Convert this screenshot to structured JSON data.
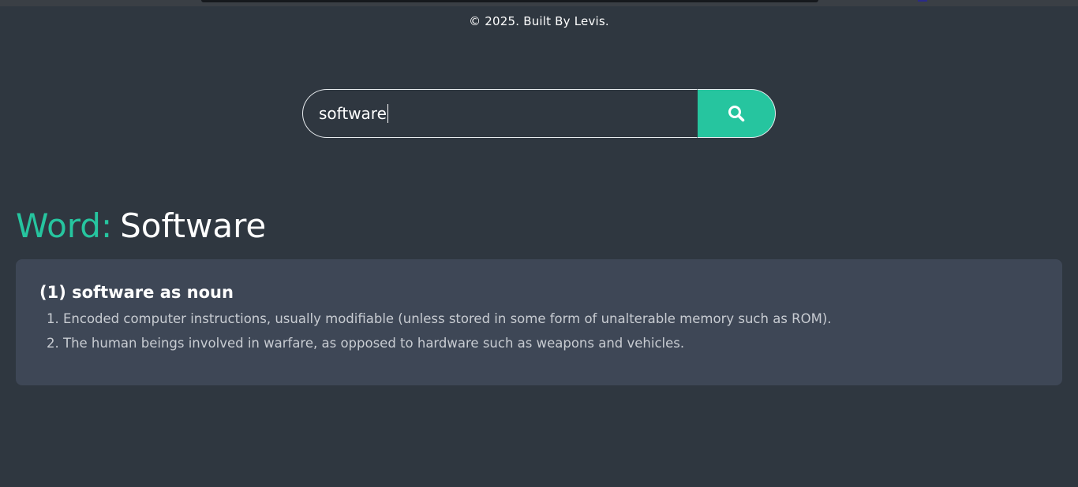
{
  "footer": {
    "credit": "© 2025. Built By Levis."
  },
  "search": {
    "value": "software",
    "button_icon": "search-icon"
  },
  "result": {
    "word_label": "Word:",
    "word": "Software",
    "meanings": [
      {
        "title": "(1) software as noun",
        "definitions": [
          "Encoded computer instructions, usually modifiable (unless stored in some form of unalterable memory such as ROM).",
          "The human beings involved in warfare, as opposed to hardware such as weapons and vehicles."
        ]
      }
    ]
  },
  "colors": {
    "background": "#2f3740",
    "accent": "#26c59f",
    "card": "#3e4756"
  }
}
